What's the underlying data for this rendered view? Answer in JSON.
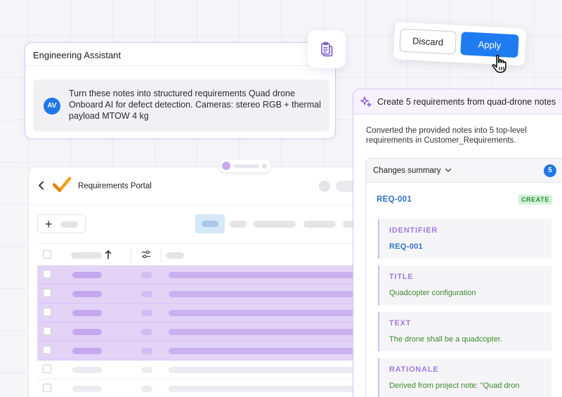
{
  "assistant": {
    "title": "Engineering Assistant",
    "avatar": "AV",
    "message": "Turn these notes into structured requirements Quad drone Onboard AI for defect detection. Cameras: stereo RGB + thermal payload MTOW 4 kg"
  },
  "actions": {
    "discard_label": "Discard",
    "apply_label": "Apply"
  },
  "portal": {
    "title": "Requirements Portal"
  },
  "panel": {
    "title": "Create 5 requirements from quad-drone notes",
    "description": "Converted the provided notes into 5 top-level requirements in Customer_Requirements.",
    "changes_label": "Changes summary",
    "changes_count": "5",
    "req_id": "REQ-001",
    "badge": "CREATE",
    "fields": [
      {
        "label": "IDENTIFIER",
        "value": "REQ-001"
      },
      {
        "label": "TITLE",
        "value": "Quadcopter configuration"
      },
      {
        "label": "TEXT",
        "value": "The drone shall be a quadcopter."
      },
      {
        "label": "RATIONALE",
        "value": "Derived from project note: \"Quad dron"
      }
    ]
  },
  "colors": {
    "accent_purple": "#d7c3f0",
    "selection": "#e2d3f7",
    "primary_blue": "#1f7cf0",
    "create_green": "#2d8a3c"
  },
  "icons": [
    "clipboard-icon",
    "cursor-hand-icon",
    "back-arrow-icon",
    "checkmark-logo-icon",
    "plus-icon",
    "sort-up-icon",
    "filter-sliders-icon",
    "sparkle-icon",
    "chevron-down-icon"
  ]
}
